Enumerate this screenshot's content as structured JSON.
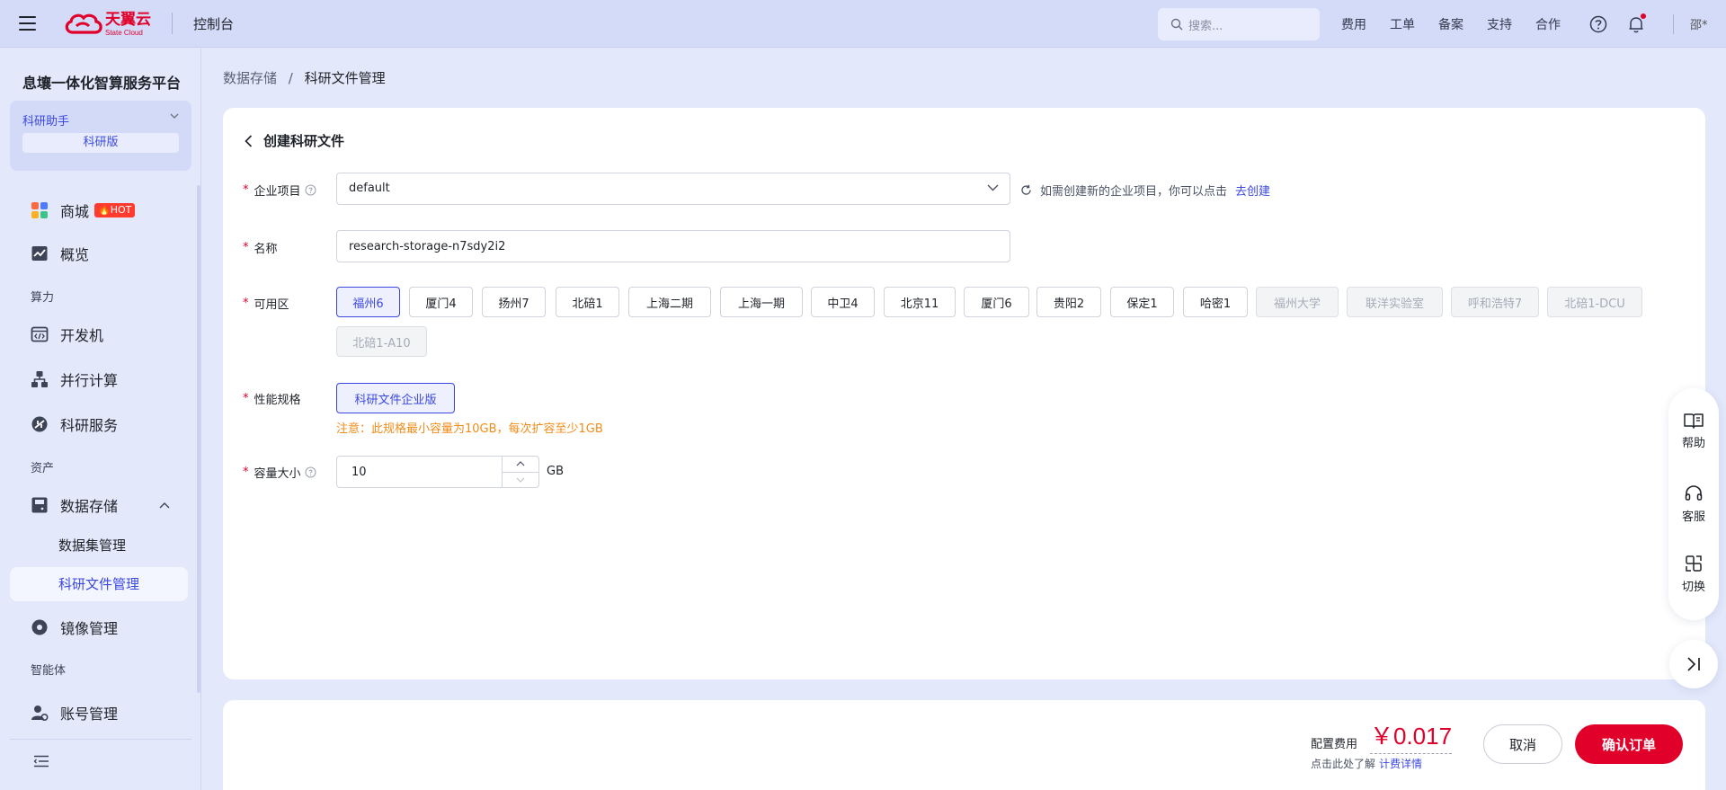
{
  "header": {
    "brand_cn": "天翼云",
    "brand_en": "State Cloud",
    "console_title": "控制台",
    "search_placeholder": "搜索...",
    "links": [
      "费用",
      "工单",
      "备案",
      "支持",
      "合作"
    ],
    "user": "邵*"
  },
  "sidebar": {
    "platform_title": "息壤一体化智算服务平台",
    "assistant_name": "科研助手",
    "assistant_edition": "科研版",
    "store": "商城",
    "hot_badge": "🔥HOT",
    "overview": "概览",
    "section_compute": "算力",
    "dev_machine": "开发机",
    "parallel_compute": "并行计算",
    "research_service": "科研服务",
    "section_assets": "资产",
    "data_storage": "数据存储",
    "dataset_mgmt": "数据集管理",
    "research_file_mgmt": "科研文件管理",
    "image_mgmt": "镜像管理",
    "section_agent": "智能体",
    "account_mgmt": "账号管理"
  },
  "breadcrumb": {
    "parent": "数据存储",
    "separator": "/",
    "current": "科研文件管理"
  },
  "form": {
    "title": "创建科研文件",
    "required_mark": "*",
    "project_label": "企业项目",
    "project_value": "default",
    "project_hint": "如需创建新的企业项目，你可以点击",
    "project_hint_link": "去创建",
    "name_label": "名称",
    "name_value": "research-storage-n7sdy2i2",
    "zone_label": "可用区",
    "zones": [
      "福州6",
      "厦门4",
      "扬州7",
      "北碚1",
      "上海二期",
      "上海一期",
      "中卫4",
      "北京11",
      "厦门6",
      "贵阳2",
      "保定1",
      "哈密1",
      "福州大学",
      "联洋实验室",
      "呼和浩特7",
      "北碚1-DCU",
      "北碚1-A10"
    ],
    "spec_label": "性能规格",
    "spec_value": "科研文件企业版",
    "spec_note": "注意：此规格最小容量为10GB，每次扩容至少1GB",
    "capacity_label": "容量大小",
    "capacity_value": "10",
    "capacity_unit": "GB"
  },
  "footer": {
    "fee_label": "配置费用",
    "fee_value": "￥0.017",
    "fee_hint": "点击此处了解",
    "fee_hint_link": "计费详情",
    "cancel": "取消",
    "confirm": "确认订单"
  },
  "float_panel": {
    "help": "帮助",
    "service": "客服",
    "switch": "切换"
  },
  "colors": {
    "brand_red": "#e0002a",
    "accent_blue": "#3b48e0",
    "warning_orange": "#f08c1a"
  }
}
